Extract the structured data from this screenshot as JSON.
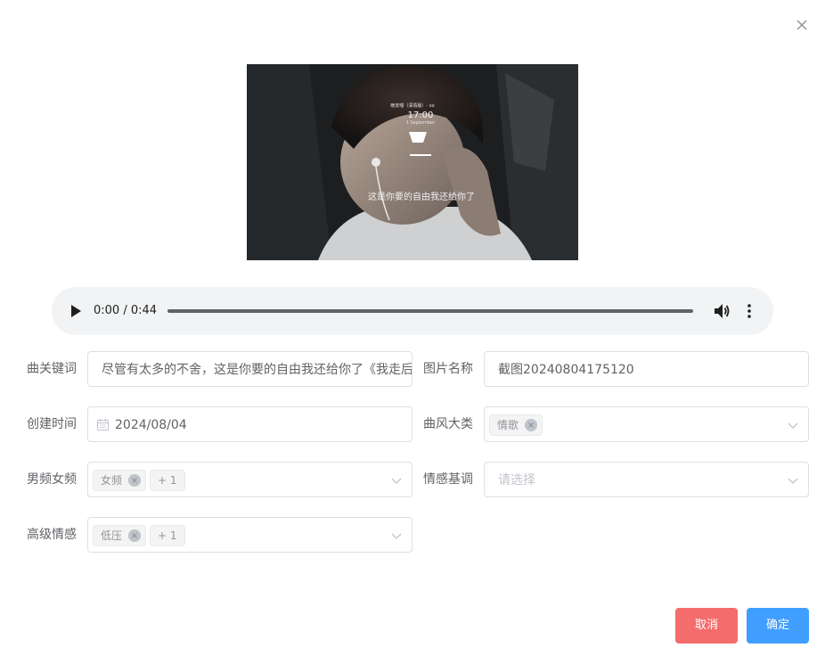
{
  "audio": {
    "time": "0:00 / 0:44"
  },
  "cover": {
    "overlay_song": "晚安喵（深情版）- xx",
    "overlay_time": "17:00",
    "overlay_date": "1 September",
    "overlay_subtitle": "这是你要的自由我还给你了"
  },
  "form": {
    "keywords": {
      "label": "曲关键词",
      "value": "尽管有太多的不舍，这是你要的自由我还给你了《我走后"
    },
    "image_name": {
      "label": "图片名称",
      "value": "截图20240804175120"
    },
    "created": {
      "label": "创建时间",
      "value": "2024/08/04"
    },
    "style": {
      "label": "曲风大类",
      "tags": [
        "情歌"
      ]
    },
    "gender": {
      "label": "男频女频",
      "tags": [
        "女频"
      ],
      "more": "+ 1"
    },
    "mood": {
      "label": "情感基调",
      "placeholder": "请选择"
    },
    "advanced": {
      "label": "高级情感",
      "tags": [
        "低压"
      ],
      "more": "+ 1"
    }
  },
  "buttons": {
    "cancel": "取消",
    "ok": "确定"
  },
  "colors": {
    "primary": "#409eff",
    "danger": "#f56c6c",
    "border": "#dcdfe6"
  }
}
